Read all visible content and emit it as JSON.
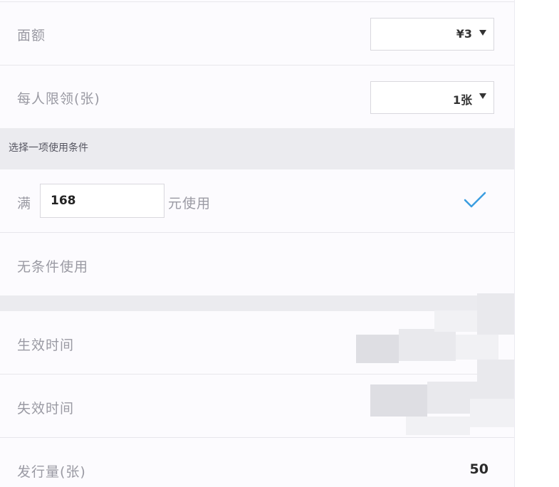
{
  "face_value": {
    "label": "面额",
    "selected": "¥3"
  },
  "per_person_limit": {
    "label": "每人限领(张)",
    "selected": "1张"
  },
  "usage_condition": {
    "section_title": "选择一项使用条件",
    "threshold_prefix": "满",
    "threshold_value": "168",
    "threshold_suffix": "元使用",
    "threshold_selected": true,
    "no_condition_label": "无条件使用",
    "accent_color": "#3b9de0"
  },
  "validity": {
    "start_label": "生效时间",
    "end_label": "失效时间"
  },
  "issue_quantity": {
    "label": "发行量(张)",
    "value": "50"
  }
}
